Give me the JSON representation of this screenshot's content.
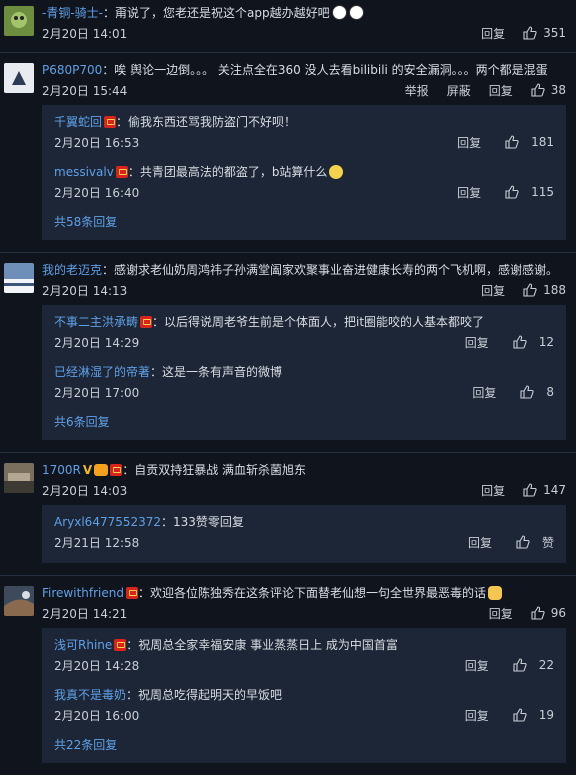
{
  "ui": {
    "reply": "回复",
    "report": "举报",
    "block": "屏蔽"
  },
  "comments": [
    {
      "name": "-青铜-骑士-",
      "text": "：甭说了，您老还是祝这个app越办越好吧",
      "time": "2月20日 14:01",
      "likes": "351",
      "replies": [],
      "more": ""
    },
    {
      "name": "P680P700",
      "text": "：唉 舆论一边倒。。。 关注点全在360 没人去看bilibili 的安全漏洞。。。两个都是混蛋",
      "time": "2月20日 15:44",
      "likes": "38",
      "replies": [
        {
          "name": "千翼蛇回",
          "text": "：偷我东西还骂我防盗门不好呗！",
          "time": "2月20日 16:53",
          "likes": "181"
        },
        {
          "name": "messivalv",
          "text": "：共青团最高法的都盗了，b站算什么",
          "time": "2月20日 16:40",
          "likes": "115"
        }
      ],
      "more": "共58条回复"
    },
    {
      "name": "我的老迈克",
      "text": "：感谢求老仙奶周鸿祎子孙满堂阖家欢聚事业奋进健康长寿的两个飞机啊，感谢感谢。",
      "time": "2月20日 14:13",
      "likes": "188",
      "replies": [
        {
          "name": "不事二主洪承畴",
          "text": "：以后得说周老爷生前是个体面人，把it圈能咬的人基本都咬了",
          "time": "2月20日 14:29",
          "likes": "12"
        },
        {
          "name": "已经淋湿了的帝著",
          "text": "：这是一条有声音的微博",
          "time": "2月20日 17:00",
          "likes": "8"
        }
      ],
      "more": "共6条回复"
    },
    {
      "name": "1700R",
      "text": "：自贡双持狂暴战 满血斩杀菌旭东",
      "time": "2月20日 14:03",
      "likes": "147",
      "replies": [
        {
          "name": "Aryxl6477552372",
          "text": "：133赞零回复",
          "time": "2月21日 12:58",
          "likes": "赞"
        }
      ],
      "more": ""
    },
    {
      "name": "Firewithfriend",
      "text": "：欢迎各位陈独秀在这条评论下面替老仙想一句全世界最恶毒的话",
      "time": "2月20日 14:21",
      "likes": "96",
      "replies": [
        {
          "name": "浅可Rhine",
          "text": "：祝周总全家幸福安康 事业蒸蒸日上 成为中国首富",
          "time": "2月20日 14:28",
          "likes": "22"
        },
        {
          "name": "我真不是毒奶",
          "text": "：祝周总吃得起明天的早饭吧",
          "time": "2月20日 16:00",
          "likes": "19"
        }
      ],
      "more": "共22条回复"
    }
  ]
}
